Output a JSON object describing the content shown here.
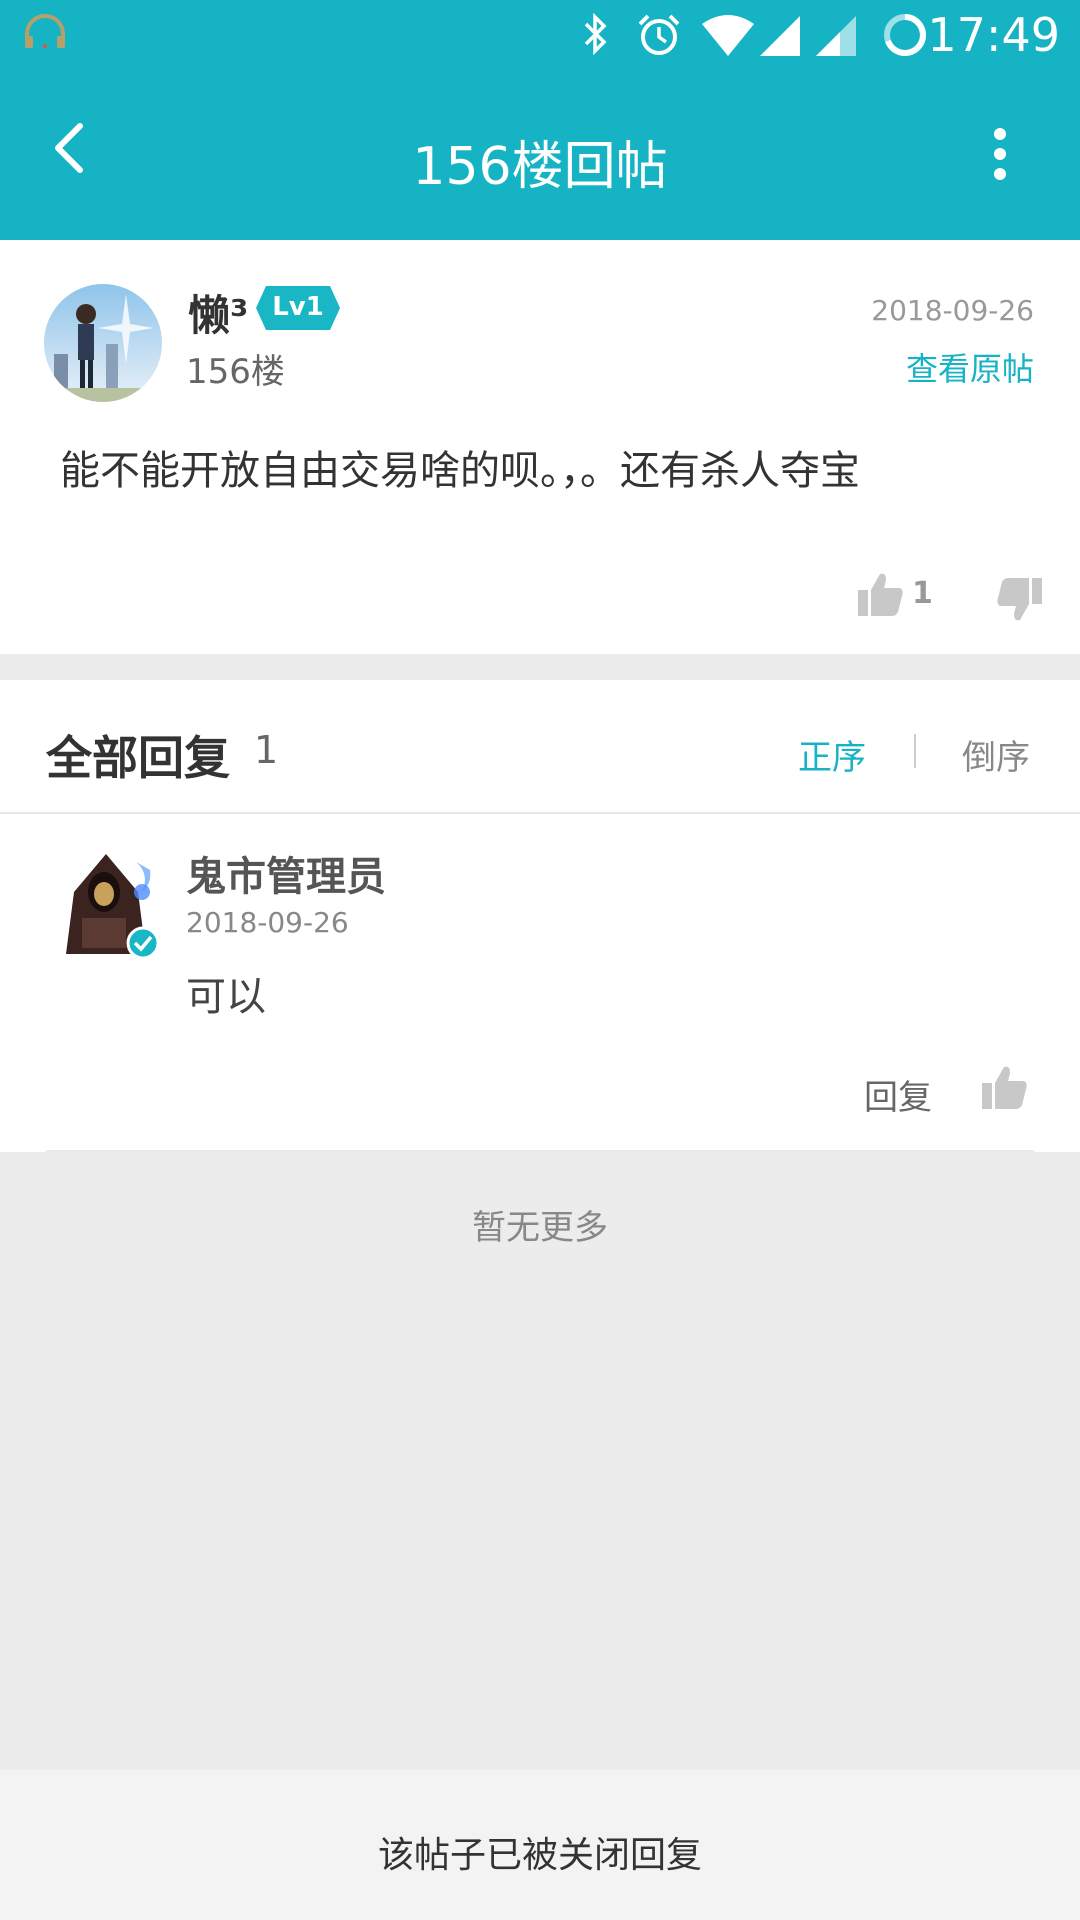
{
  "status_bar": {
    "time": "17:49",
    "icons": [
      "headset-icon",
      "bluetooth-icon",
      "alarm-icon",
      "wifi-icon",
      "signal-icon",
      "signal-icon-2",
      "battery-ring-icon"
    ]
  },
  "nav": {
    "title": "156楼回帖",
    "back_icon": "chevron-left-icon",
    "more_icon": "more-vertical-icon"
  },
  "post": {
    "author": "懒³",
    "level": "Lv1",
    "floor": "156楼",
    "date": "2018-09-26",
    "view_original": "查看原帖",
    "content": "能不能开放自由交易啥的呗。，。还有杀人夺宝",
    "like_count": "1"
  },
  "replies_header": {
    "title": "全部回复",
    "count": "1",
    "sort_asc": "正序",
    "sort_desc": "倒序"
  },
  "replies": [
    {
      "author": "鬼市管理员",
      "date": "2018-09-26",
      "text": "可以",
      "reply_label": "回复"
    }
  ],
  "no_more": "暂无更多",
  "footer": {
    "closed_text": "该帖子已被关闭回复"
  },
  "colors": {
    "accent": "#16b3c4",
    "background": "#ececec"
  }
}
